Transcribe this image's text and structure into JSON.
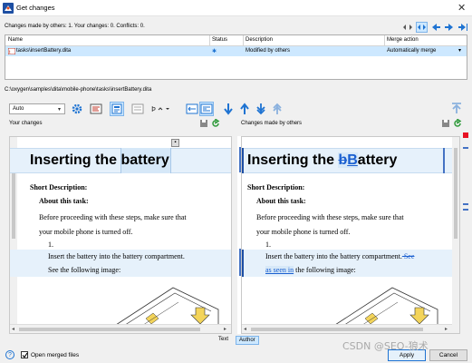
{
  "window": {
    "title": "Get changes",
    "close": "✕"
  },
  "stats": {
    "text": "Changes made by others: 1.  Your changes: 0.  Conflicts: 0."
  },
  "table": {
    "columns": [
      "Name",
      "Status",
      "Description",
      "Merge action"
    ],
    "rows": [
      {
        "name": "tasks\\insertBattery.dita",
        "status": "✱",
        "description": "Modified by others",
        "merge_action": "Automatically merge"
      }
    ]
  },
  "file_path": "C:\\oxygen\\samples\\dita\\mobile-phone\\tasks\\insertBattery.dita",
  "toolbar": {
    "mode_value": "Auto",
    "dropdown_arrow": "▾"
  },
  "left_panel": {
    "label": "Your changes",
    "heading": "Inserting the battery",
    "short_desc": "Short Description:",
    "about": "About this task:",
    "para1": "Before proceeding with these steps, make sure that",
    "para2": "your mobile phone is turned off.",
    "step_num": "1.",
    "step1": "Insert the battery into the battery compartment.",
    "step2": "See the following image:"
  },
  "right_panel": {
    "label": "Changes made by others",
    "heading_prefix": "Inserting the ",
    "heading_old": "b",
    "heading_new": "B",
    "heading_suffix": "attery",
    "short_desc": "Short Description:",
    "about": "About this task:",
    "para1": "Before proceeding with these steps, make sure that",
    "para2": "your mobile phone is turned off.",
    "step_num": "1.",
    "step1a": "Insert the battery into the battery compartment.",
    "step1b_deleted": " See",
    "step2_inserted": "as seen in",
    "step2_rest": " the following image:"
  },
  "view_tabs": {
    "text": "Text",
    "author": "Author",
    "active": "Author"
  },
  "footer": {
    "help": "?",
    "checkbox_label": "Open merged files",
    "checkbox_checked": true,
    "apply": "Apply",
    "cancel": "Cancel"
  },
  "watermark": "CSDN @SEO-狼术",
  "colors": {
    "accent": "#1e73d2",
    "selection": "#cde8ff",
    "change_band": "#e6f1fb",
    "deleted": "#1a5fd0",
    "close_red": "#e81123"
  }
}
